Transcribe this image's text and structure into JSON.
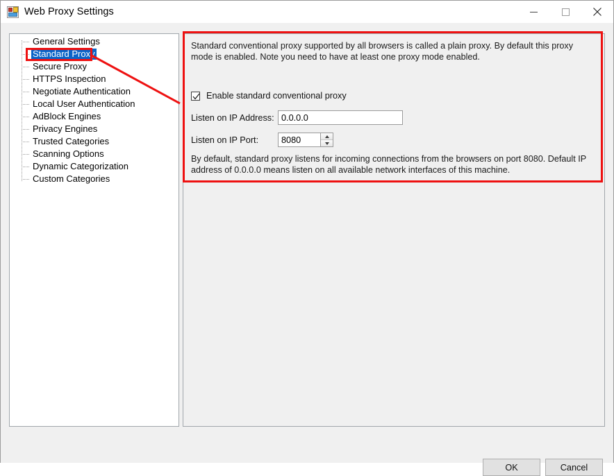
{
  "window": {
    "title": "Web Proxy Settings",
    "icon": "winforms-app-icon",
    "controls": {
      "minimize": "minimize-icon",
      "maximize": "maximize-icon",
      "close": "close-icon"
    }
  },
  "tree": {
    "items": [
      {
        "label": "General Settings",
        "selected": false
      },
      {
        "label": "Standard Proxy",
        "selected": true
      },
      {
        "label": "Secure Proxy",
        "selected": false
      },
      {
        "label": "HTTPS Inspection",
        "selected": false
      },
      {
        "label": "Negotiate Authentication",
        "selected": false
      },
      {
        "label": "Local User Authentication",
        "selected": false
      },
      {
        "label": "AdBlock Engines",
        "selected": false
      },
      {
        "label": "Privacy Engines",
        "selected": false
      },
      {
        "label": "Trusted Categories",
        "selected": false
      },
      {
        "label": "Scanning Options",
        "selected": false
      },
      {
        "label": "Dynamic Categorization",
        "selected": false
      },
      {
        "label": "Custom Categories",
        "selected": false
      }
    ]
  },
  "panel": {
    "description": "Standard conventional proxy supported by all browsers is called a plain proxy. By default this proxy mode is enabled. Note you need to have at least one proxy mode enabled.",
    "enable_checkbox_label": "Enable standard conventional proxy",
    "enable_checkbox_checked": true,
    "ip_label": "Listen on IP Address:",
    "ip_value": "0.0.0.0",
    "port_label": "Listen on IP Port:",
    "port_value": "8080",
    "note": "By default, standard proxy listens for incoming connections from the browsers on port 8080. Default IP address of 0.0.0.0 means listen on all available network interfaces of this machine."
  },
  "footer": {
    "ok_label": "OK",
    "cancel_label": "Cancel"
  },
  "annotations": {
    "accent_color": "#ee1111",
    "selection_color": "#0a64c8"
  }
}
